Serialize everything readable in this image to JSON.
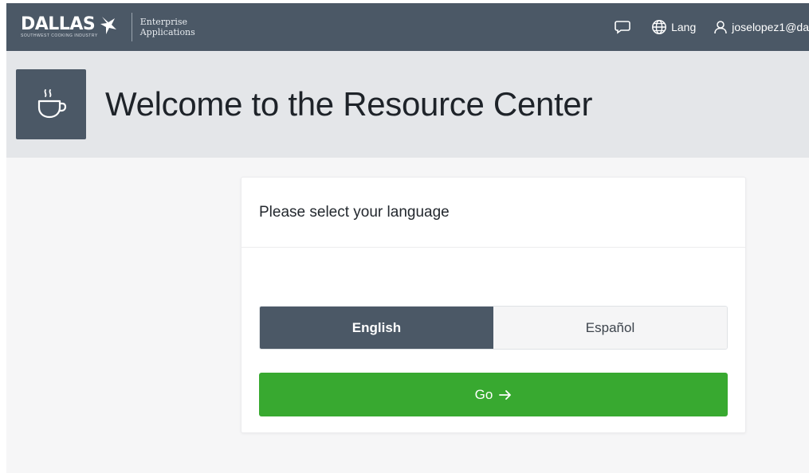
{
  "topbar": {
    "logo_text": "DALLAS",
    "logo_tagline": "Southwest Cooking Industry",
    "subtitle_line1": "Enterprise",
    "subtitle_line2": "Applications",
    "lang_label": "Lang",
    "user_label": "joselopez1@da"
  },
  "header": {
    "title": "Welcome to the Resource Center",
    "icon": "coffee-cup-icon"
  },
  "card": {
    "title": "Please select your language",
    "languages": [
      {
        "label": "English",
        "selected": true
      },
      {
        "label": "Español",
        "selected": false
      }
    ],
    "go_label": "Go"
  },
  "colors": {
    "nav_bg": "#4b5866",
    "header_bg": "#e4e6e9",
    "accent_green": "#38a930",
    "selected_bg": "#4b5866"
  }
}
